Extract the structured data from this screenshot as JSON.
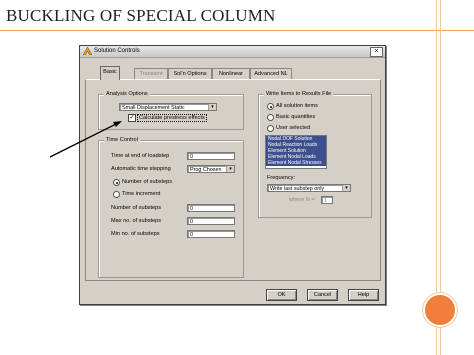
{
  "slide": {
    "title": "BUCKLING OF SPECIAL COLUMN"
  },
  "dialog": {
    "title": "Solution Controls",
    "close_label": "×",
    "tabs": [
      {
        "label": "Basic",
        "active": true
      },
      {
        "label": "Transient",
        "disabled": true
      },
      {
        "label": "Sol'n Options"
      },
      {
        "label": "Nonlinear"
      },
      {
        "label": "Advanced NL"
      }
    ],
    "analysis": {
      "legend": "Analysis Options",
      "type_value": "Small Displacement Static",
      "prestress_label": "Calculate prestress effects",
      "prestress_checked": true
    },
    "time": {
      "legend": "Time Control",
      "end_time_label": "Time at end of loadstep",
      "end_time_value": "0",
      "stepping_label": "Automatic time stepping",
      "stepping_value": "Prog Chosen",
      "num_substeps_radio": "Number of substeps",
      "time_increment_radio": "Time increment",
      "num_substeps_label": "Number of substeps",
      "num_substeps_value": "0",
      "max_substeps_label": "Max no. of substeps",
      "max_substeps_value": "0",
      "min_substeps_label": "Min no. of substeps",
      "min_substeps_value": "0"
    },
    "write": {
      "legend": "Write Items to Results File",
      "all_items": "All solution items",
      "basic_qty": "Basic quantities",
      "user_selected": "User selected",
      "list_items": [
        "Nodal DOF Solution",
        "Nodal Reaction Loads",
        "Element Solution",
        "Element Nodal Loads",
        "Element Nodal Stresses"
      ],
      "frequency_label": "Frequency:",
      "frequency_value": "Write last substep only",
      "where_label": "where N =",
      "where_value": "1"
    },
    "buttons": {
      "ok": "OK",
      "cancel": "Cancel",
      "help": "Help"
    }
  },
  "colors": {
    "accent_orange": "#ef7f3a",
    "dialog_bg": "#d4d0c8",
    "list_selected": "#3d4f8c"
  }
}
